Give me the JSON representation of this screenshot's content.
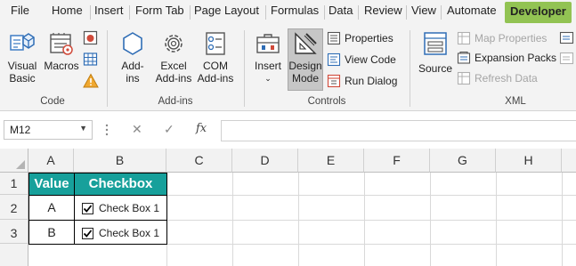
{
  "tabs": [
    "File",
    "Home",
    "Insert",
    "Form Tab",
    "Page Layout",
    "Formulas",
    "Data",
    "Review",
    "View",
    "Automate",
    "Developer"
  ],
  "active_tab": "Developer",
  "ribbon": {
    "code": {
      "label": "Code",
      "visual_basic": [
        "Visual",
        "Basic"
      ],
      "macros": "Macros"
    },
    "addins": {
      "label": "Add-ins",
      "addins_btn": [
        "Add-",
        "ins"
      ],
      "excel_addins": [
        "Excel",
        "Add-ins"
      ],
      "com_addins": [
        "COM",
        "Add-ins"
      ]
    },
    "controls": {
      "label": "Controls",
      "insert": "Insert",
      "design_mode": [
        "Design",
        "Mode"
      ],
      "properties": "Properties",
      "view_code": "View Code",
      "run_dialog": "Run Dialog"
    },
    "xml": {
      "label": "XML",
      "source": "Source",
      "map_properties": "Map Properties",
      "expansion_packs": "Expansion Packs",
      "refresh_data": "Refresh Data"
    }
  },
  "formula_bar": {
    "name_box": "M12",
    "fx": "fx",
    "cancel": "✕",
    "enter": "✓",
    "formula": ""
  },
  "grid": {
    "columns": [
      "A",
      "B",
      "C",
      "D",
      "E",
      "F",
      "G",
      "H"
    ],
    "rows": [
      "1",
      "2",
      "3"
    ],
    "table": {
      "headers": [
        "Value",
        "Checkbox"
      ],
      "rows": [
        {
          "value": "A",
          "checkbox": "Check Box 1",
          "checked": true
        },
        {
          "value": "B",
          "checkbox": "Check Box 1",
          "checked": true
        }
      ]
    }
  },
  "colors": {
    "accent": "#92c353",
    "table_header": "#17a09b"
  }
}
